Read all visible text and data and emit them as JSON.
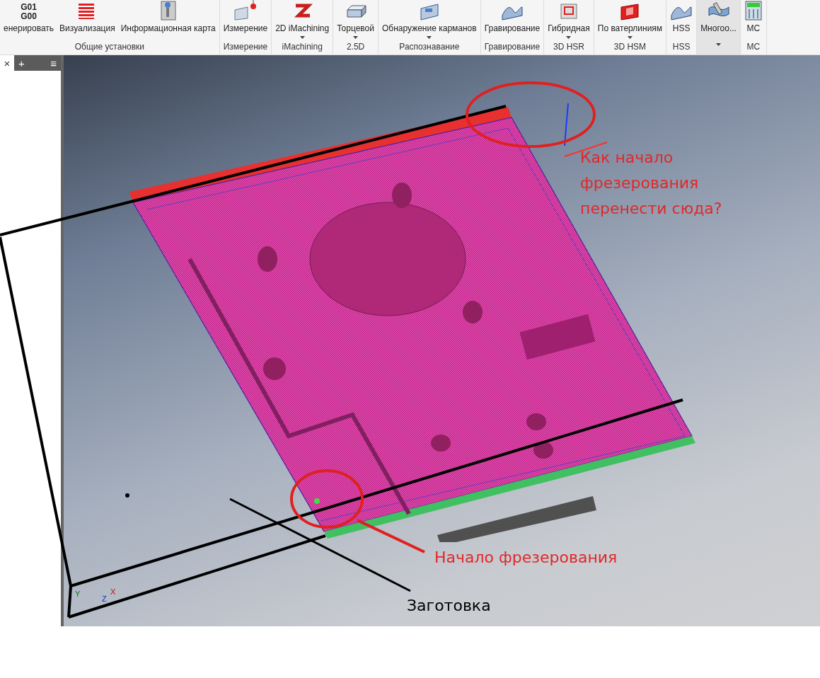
{
  "ribbon": {
    "groups": [
      {
        "label": "Общие установки",
        "highlighted": false,
        "buttons": [
          {
            "label": "енерировать",
            "icon_text": [
              "G01",
              "G00"
            ],
            "dropdown": false
          },
          {
            "label": "Визуализация",
            "dropdown": false
          },
          {
            "label": "Информационная карта",
            "dropdown": false
          }
        ]
      },
      {
        "label": "Измерение",
        "highlighted": false,
        "buttons": [
          {
            "label": "Измерение",
            "dropdown": false
          }
        ]
      },
      {
        "label": "iMachining",
        "highlighted": false,
        "buttons": [
          {
            "label": "2D iMachining",
            "dropdown": true
          }
        ]
      },
      {
        "label": "2.5D",
        "highlighted": false,
        "buttons": [
          {
            "label": "Торцевой",
            "dropdown": true
          }
        ]
      },
      {
        "label": "Распознавание",
        "highlighted": false,
        "buttons": [
          {
            "label": "Обнаружение карманов",
            "dropdown": true
          }
        ]
      },
      {
        "label": "Гравирование",
        "highlighted": false,
        "buttons": [
          {
            "label": "Гравирование",
            "dropdown": false
          }
        ]
      },
      {
        "label": "3D HSR",
        "highlighted": false,
        "buttons": [
          {
            "label": "Гибридная",
            "dropdown": true
          }
        ]
      },
      {
        "label": "3D HSM",
        "highlighted": false,
        "buttons": [
          {
            "label": "По ватерлиниям",
            "dropdown": true
          }
        ]
      },
      {
        "label": "HSS",
        "highlighted": false,
        "buttons": [
          {
            "label": "HSS",
            "dropdown": false
          }
        ]
      },
      {
        "footer_caret": true,
        "highlighted": true,
        "buttons": [
          {
            "label": "Многоо...",
            "dropdown": false
          }
        ]
      },
      {
        "label": "MC",
        "highlighted": false,
        "buttons": [
          {
            "label": "MC",
            "dropdown": false
          }
        ]
      }
    ]
  },
  "side_panel": {
    "close": "×",
    "add": "+",
    "menu": "≡"
  },
  "viewport": {
    "triad": {
      "x": "X",
      "y": "Y",
      "z": "Z"
    }
  },
  "annotations": [
    {
      "text": "Как начало фрезерования перенести сюда?",
      "color": "#e0282a"
    },
    {
      "text": "Начало фрезерования",
      "color": "#e0282a"
    },
    {
      "text": "Заготовка",
      "color": "#000000"
    }
  ]
}
